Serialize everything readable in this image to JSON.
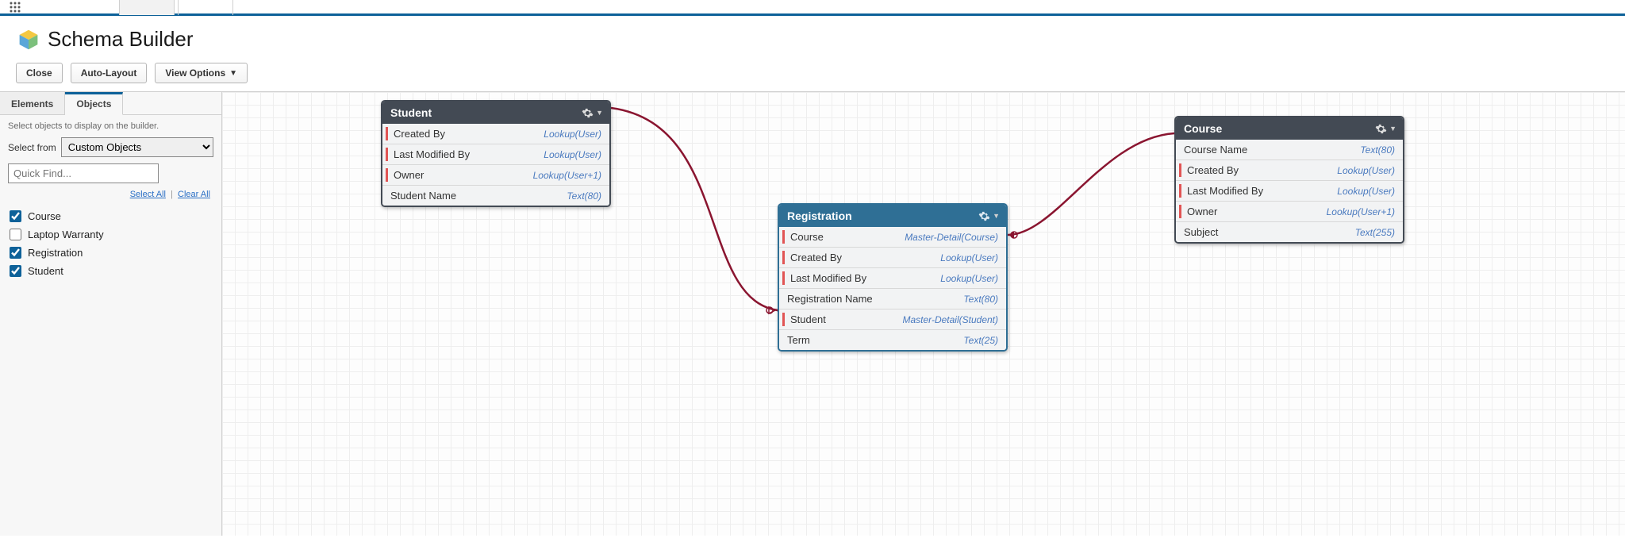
{
  "header": {
    "title": "Schema Builder"
  },
  "toolbar": {
    "close": "Close",
    "auto_layout": "Auto-Layout",
    "view_options": "View Options"
  },
  "sidebar": {
    "tabs": {
      "elements": "Elements",
      "objects": "Objects"
    },
    "help": "Select objects to display on the builder.",
    "select_from_label": "Select from",
    "select_from_value": "Custom Objects",
    "quick_find_placeholder": "Quick Find...",
    "select_all": "Select All",
    "clear_all": "Clear All",
    "objects": [
      {
        "label": "Course",
        "checked": true
      },
      {
        "label": "Laptop Warranty",
        "checked": false
      },
      {
        "label": "Registration",
        "checked": true
      },
      {
        "label": "Student",
        "checked": true
      }
    ]
  },
  "nodes": {
    "student": {
      "title": "Student",
      "fields": [
        {
          "name": "Created By",
          "type": "Lookup(User)",
          "req": true
        },
        {
          "name": "Last Modified By",
          "type": "Lookup(User)",
          "req": true
        },
        {
          "name": "Owner",
          "type": "Lookup(User+1)",
          "req": true
        },
        {
          "name": "Student Name",
          "type": "Text(80)",
          "req": false
        }
      ]
    },
    "registration": {
      "title": "Registration",
      "fields": [
        {
          "name": "Course",
          "type": "Master-Detail(Course)",
          "req": true
        },
        {
          "name": "Created By",
          "type": "Lookup(User)",
          "req": true
        },
        {
          "name": "Last Modified By",
          "type": "Lookup(User)",
          "req": true
        },
        {
          "name": "Registration Name",
          "type": "Text(80)",
          "req": false
        },
        {
          "name": "Student",
          "type": "Master-Detail(Student)",
          "req": true
        },
        {
          "name": "Term",
          "type": "Text(25)",
          "req": false
        }
      ]
    },
    "course": {
      "title": "Course",
      "fields": [
        {
          "name": "Course Name",
          "type": "Text(80)",
          "req": false
        },
        {
          "name": "Created By",
          "type": "Lookup(User)",
          "req": true
        },
        {
          "name": "Last Modified By",
          "type": "Lookup(User)",
          "req": true
        },
        {
          "name": "Owner",
          "type": "Lookup(User+1)",
          "req": true
        },
        {
          "name": "Subject",
          "type": "Text(255)",
          "req": false
        }
      ]
    }
  }
}
